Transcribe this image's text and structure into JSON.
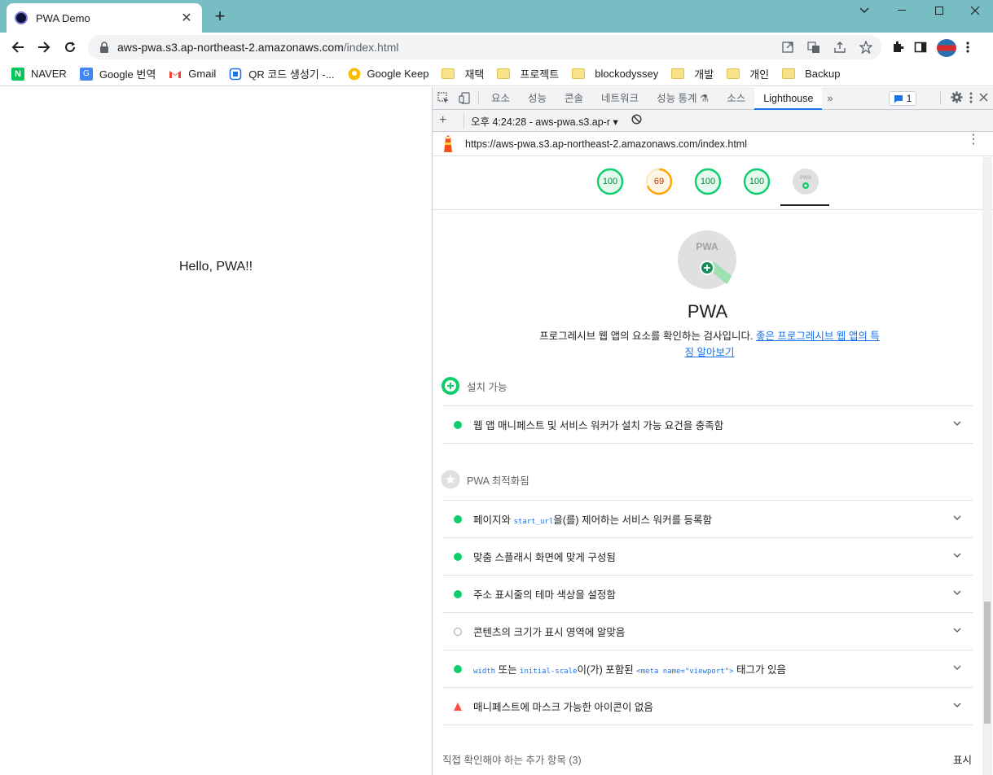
{
  "browser": {
    "tab_title": "PWA Demo",
    "url_host": "aws-pwa.s3.ap-northeast-2.amazonaws.com",
    "url_path": "/index.html"
  },
  "bookmarks": [
    {
      "label": "NAVER",
      "icon": "naver-icon",
      "color": "#03c75a"
    },
    {
      "label": "Google 번역",
      "icon": "google-translate-icon",
      "color": "#4285f4"
    },
    {
      "label": "Gmail",
      "icon": "gmail-icon",
      "color": "#ea4335"
    },
    {
      "label": "QR 코드 생성기 -...",
      "icon": "qr-icon",
      "color": "#1a73e8"
    },
    {
      "label": "Google Keep",
      "icon": "keep-icon",
      "color": "#fbbc04"
    }
  ],
  "bookmark_folders": [
    "재택",
    "프로젝트",
    "blockodyssey",
    "개발",
    "개인",
    "Backup"
  ],
  "page": {
    "text": "Hello, PWA!!"
  },
  "devtools": {
    "tabs": [
      "요소",
      "성능",
      "콘솔",
      "네트워크",
      "성능 통계",
      "소스",
      "Lighthouse"
    ],
    "active_tab": "Lighthouse",
    "issues_count": "1",
    "report_label": "오후 4:24:28 - aws-pwa.s3.ap-r",
    "report_url": "https://aws-pwa.s3.ap-northeast-2.amazonaws.com/index.html",
    "scores": [
      {
        "value": "100",
        "color": "#0cce6b",
        "fraction": 1.0
      },
      {
        "value": "69",
        "color": "#ffa400",
        "fraction": 0.69
      },
      {
        "value": "100",
        "color": "#0cce6b",
        "fraction": 1.0
      },
      {
        "value": "100",
        "color": "#0cce6b",
        "fraction": 1.0
      }
    ],
    "pwa_badge_text": "PWA",
    "pwa": {
      "title": "PWA",
      "description": "프로그레시브 웹 앱의 요소를 확인하는 검사입니다. ",
      "link_text": "좋은 프로그레시브 웹 앱의 특징 알아보기"
    },
    "groups": {
      "installable": {
        "title": "설치 가능",
        "audits": [
          {
            "status": "pass",
            "text": "웹 앱 매니페스트 및 서비스 워커가 설치 가능 요건을 충족함"
          }
        ]
      },
      "optimized": {
        "title": "PWA 최적화됨",
        "audit_1_before": "페이지와 ",
        "audit_1_code": "start_url",
        "audit_1_after": "을(를) 제어하는 서비스 워커를 등록함",
        "audit_2": "맞춤 스플래시 화면에 맞게 구성됨",
        "audit_3": "주소 표시줄의 테마 색상을 설정함",
        "audit_4": "콘텐츠의 크기가 표시 영역에 알맞음",
        "audit_5_code1": "width",
        "audit_5_mid1": " 또는 ",
        "audit_5_code2": "initial-scale",
        "audit_5_mid2": "이(가) 포함된 ",
        "audit_5_code3": "<meta name=\"viewport\">",
        "audit_5_after": " 태그가 있음",
        "audit_6": "매니페스트에 마스크 가능한 아이콘이 없음"
      }
    },
    "manual": {
      "label": "직접 확인해야 하는 추가 항목",
      "count": "(3)",
      "show": "표시"
    }
  }
}
